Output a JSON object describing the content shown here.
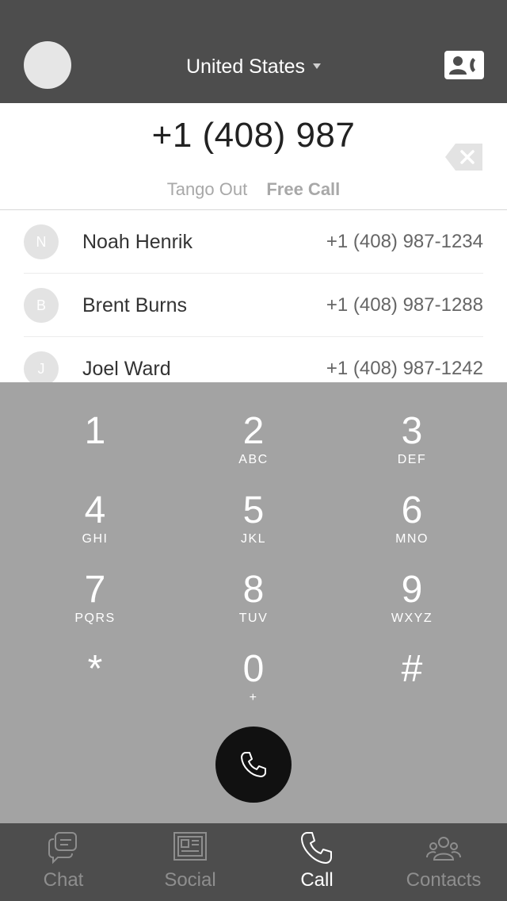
{
  "header": {
    "country": "United States"
  },
  "dialer": {
    "number": "+1 (408) 987",
    "call_type_out": "Tango Out",
    "call_type_free": "Free Call"
  },
  "contacts": [
    {
      "initial": "N",
      "name": "Noah Henrik",
      "phone": "+1 (408) 987-1234"
    },
    {
      "initial": "B",
      "name": "Brent Burns",
      "phone": "+1 (408) 987-1288"
    },
    {
      "initial": "J",
      "name": "Joel Ward",
      "phone": "+1 (408) 987-1242"
    }
  ],
  "keypad": [
    {
      "digit": "1",
      "letters": ""
    },
    {
      "digit": "2",
      "letters": "ABC"
    },
    {
      "digit": "3",
      "letters": "DEF"
    },
    {
      "digit": "4",
      "letters": "GHI"
    },
    {
      "digit": "5",
      "letters": "JKL"
    },
    {
      "digit": "6",
      "letters": "MNO"
    },
    {
      "digit": "7",
      "letters": "PQRS"
    },
    {
      "digit": "8",
      "letters": "TUV"
    },
    {
      "digit": "9",
      "letters": "WXYZ"
    },
    {
      "digit": "*",
      "letters": ""
    },
    {
      "digit": "0",
      "letters": "+"
    },
    {
      "digit": "#",
      "letters": ""
    }
  ],
  "tabs": [
    {
      "label": "Chat",
      "icon": "chat-icon",
      "active": false
    },
    {
      "label": "Social",
      "icon": "social-icon",
      "active": false
    },
    {
      "label": "Call",
      "icon": "call-icon",
      "active": true
    },
    {
      "label": "Contacts",
      "icon": "contacts-icon",
      "active": false
    }
  ],
  "colors": {
    "header_bg": "#4d4d4d",
    "keypad_bg": "#a3a3a3",
    "call_button": "#111111",
    "tab_active": "#ffffff",
    "tab_inactive": "#8e8e8e"
  }
}
